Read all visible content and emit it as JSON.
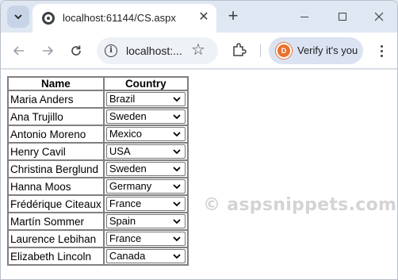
{
  "browser": {
    "tab_title": "localhost:61144/CS.aspx",
    "url": "localhost:...",
    "profile_label": "Verify it's you",
    "profile_initial": "D"
  },
  "page": {
    "watermark": "© aspsnippets.com",
    "grid": {
      "headers": [
        "Name",
        "Country"
      ],
      "rows": [
        {
          "name": "Maria Anders",
          "country": "Brazil"
        },
        {
          "name": "Ana Trujillo",
          "country": "Sweden"
        },
        {
          "name": "Antonio Moreno",
          "country": "Mexico"
        },
        {
          "name": "Henry Cavil",
          "country": "USA"
        },
        {
          "name": "Christina Berglund",
          "country": "Sweden"
        },
        {
          "name": "Hanna Moos",
          "country": "Germany"
        },
        {
          "name": "Frédérique Citeaux",
          "country": "France"
        },
        {
          "name": "Martín Sommer",
          "country": "Spain"
        },
        {
          "name": "Laurence Lebihan",
          "country": "France"
        },
        {
          "name": "Elizabeth Lincoln",
          "country": "Canada"
        }
      ]
    }
  }
}
